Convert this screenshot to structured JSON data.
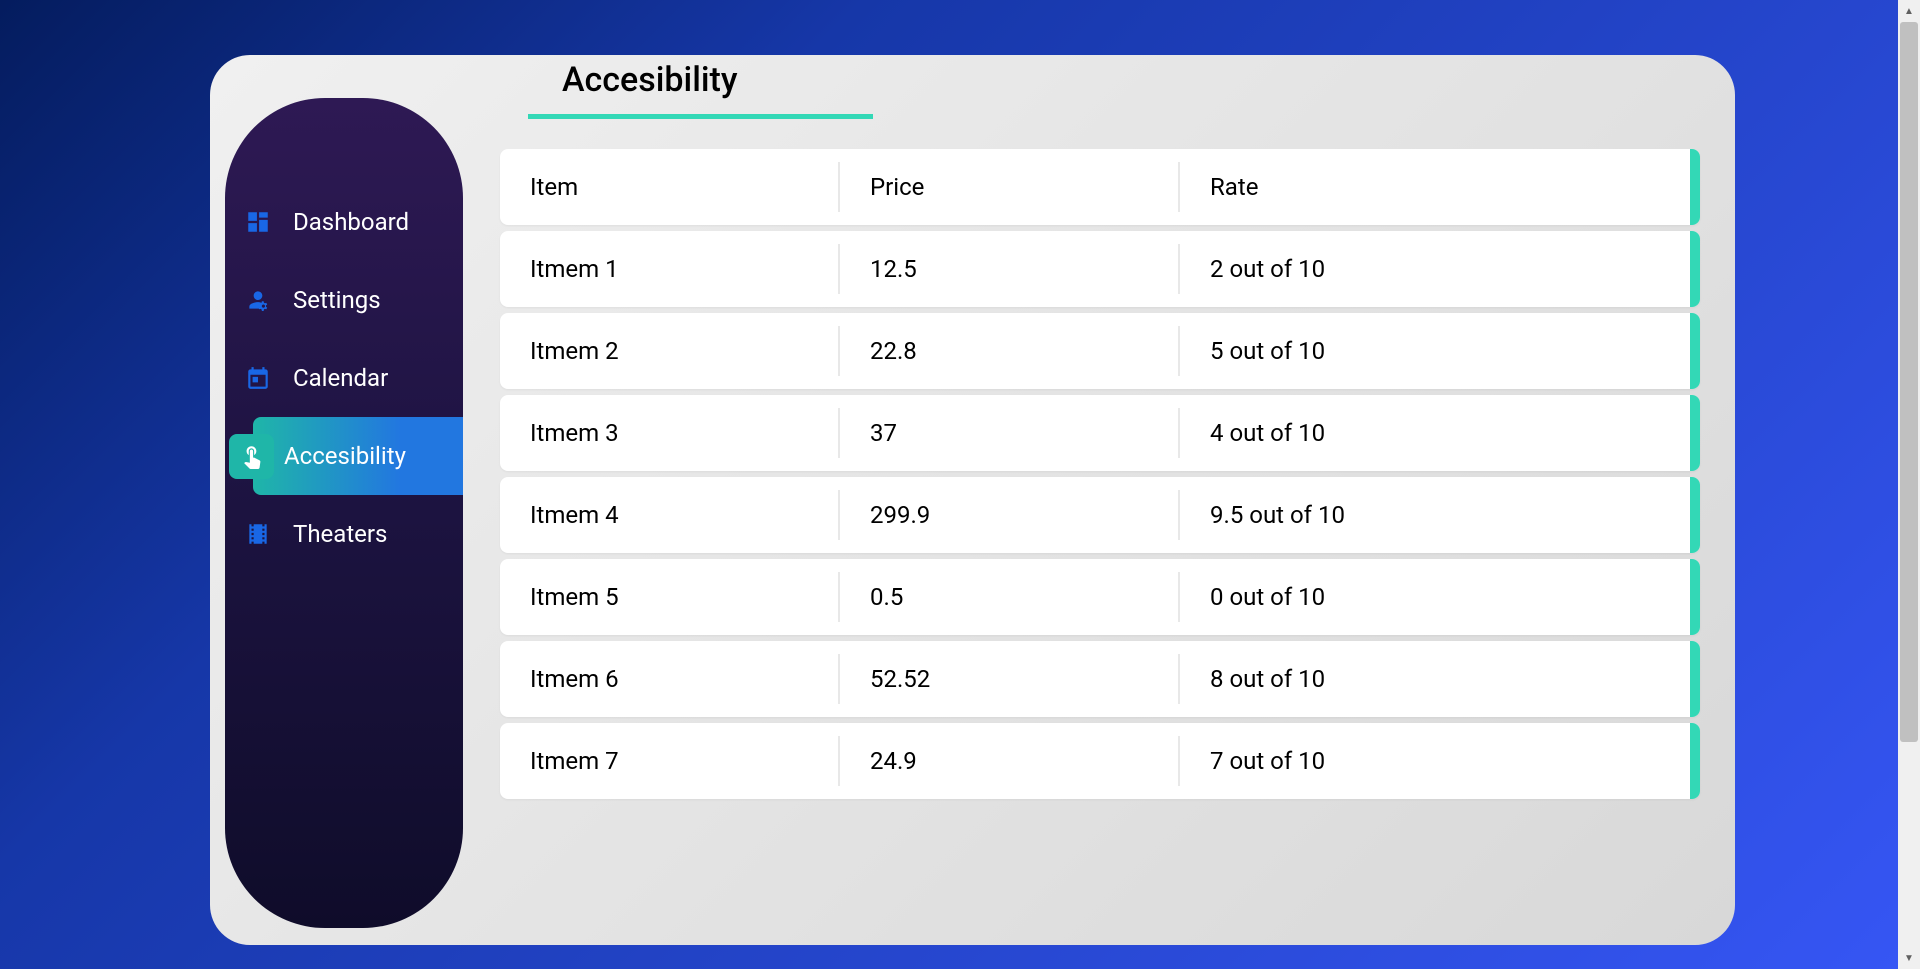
{
  "sidebar": {
    "items": [
      {
        "label": "Dashboard",
        "icon": "dashboard",
        "active": false
      },
      {
        "label": "Settings",
        "icon": "settings-user",
        "active": false
      },
      {
        "label": "Calendar",
        "icon": "calendar",
        "active": false
      },
      {
        "label": "Accesibility",
        "icon": "touch",
        "active": true
      },
      {
        "label": "Theaters",
        "icon": "theaters",
        "active": false
      }
    ]
  },
  "page": {
    "title": "Accesibility"
  },
  "table": {
    "headers": {
      "item": "Item",
      "price": "Price",
      "rate": "Rate"
    },
    "rows": [
      {
        "item": "Itmem 1",
        "price": "12.5",
        "rate": "2 out of 10"
      },
      {
        "item": "Itmem 2",
        "price": "22.8",
        "rate": "5 out of 10"
      },
      {
        "item": "Itmem 3",
        "price": "37",
        "rate": "4 out of 10"
      },
      {
        "item": "Itmem 4",
        "price": "299.9",
        "rate": "9.5 out of 10"
      },
      {
        "item": "Itmem 5",
        "price": "0.5",
        "rate": "0 out of 10"
      },
      {
        "item": "Itmem 6",
        "price": "52.52",
        "rate": "8 out of 10"
      },
      {
        "item": "Itmem 7",
        "price": "24.9",
        "rate": "7 out of 10"
      }
    ]
  },
  "colors": {
    "accent": "#33d8b6",
    "sidebar_icon": "#1967e5"
  }
}
